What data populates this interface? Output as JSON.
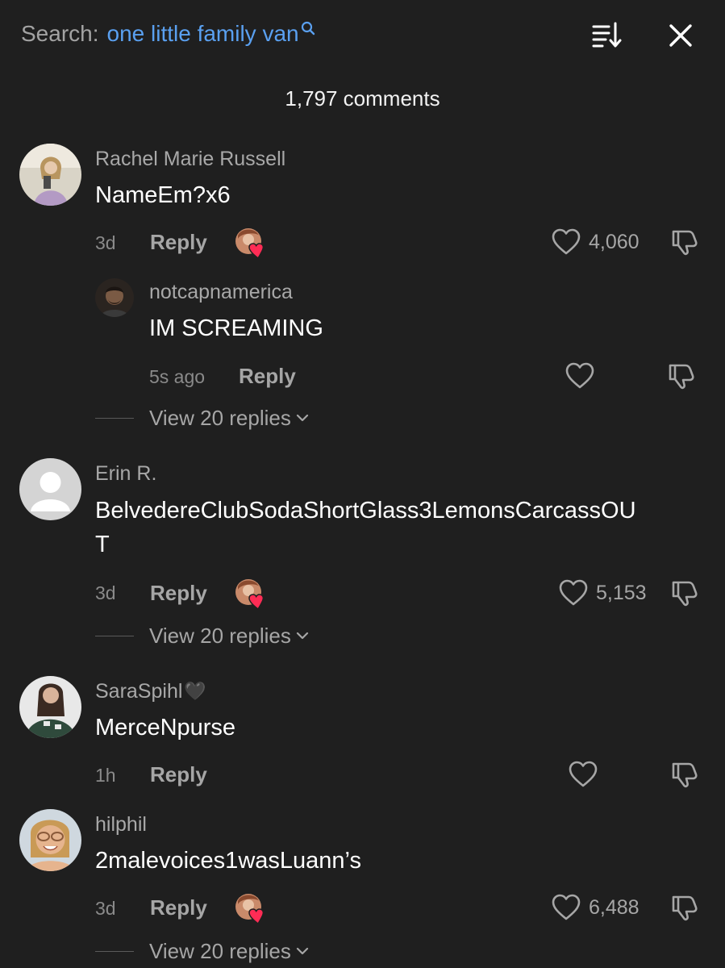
{
  "header": {
    "search_label": "Search:",
    "search_query": "one little family van",
    "comment_count": "1,797 comments"
  },
  "icons": {
    "search": "magnifier-icon",
    "sort": "sort-icon",
    "close": "close-icon",
    "like": "heart-outline-icon",
    "dislike": "thumbs-down-icon",
    "creator_liked": "creator-liked-avatar-icon",
    "expand": "chevron-down-icon"
  },
  "colors": {
    "background": "#1f1f1f",
    "query": "#5aa0f0",
    "liked_heart": "#fe2c55"
  },
  "comments": [
    {
      "username": "Rachel Marie Russell",
      "text": "NameEm?x6",
      "time": "3d",
      "reply_label": "Reply",
      "likes": "4,060",
      "creator_liked": true,
      "replies": [
        {
          "username": "notcapnamerica",
          "text": "IM SCREAMING",
          "time": "5s ago",
          "reply_label": "Reply",
          "likes": ""
        }
      ],
      "view_replies": "View 20 replies"
    },
    {
      "username": "Erin R.",
      "text_line1": "BelvedereClubSodaShortGlass3LemonsCarcassOU",
      "text_line2": "T",
      "time": "3d",
      "reply_label": "Reply",
      "likes": "5,153",
      "creator_liked": true,
      "view_replies": "View 20 replies"
    },
    {
      "username": "SaraSpihl",
      "username_emoji": "🖤",
      "text": "MerceNpurse",
      "time": "1h",
      "reply_label": "Reply",
      "likes": "",
      "creator_liked": false
    },
    {
      "username": "hilphil",
      "text": "2malevoices1wasLuann’s",
      "time": "3d",
      "reply_label": "Reply",
      "likes": "6,488",
      "creator_liked": true,
      "view_replies": "View 20 replies"
    }
  ]
}
